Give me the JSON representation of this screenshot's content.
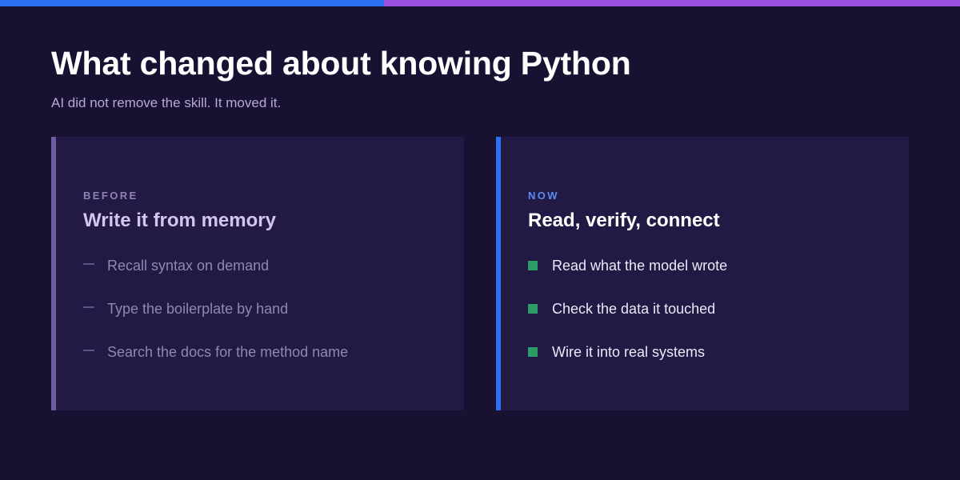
{
  "colors": {
    "background": "#181131",
    "card_background": "#221a44",
    "accent_blue": "#2d6ff2",
    "accent_purple": "#9b51e0",
    "before_border": "#6e5ca3",
    "before_kicker": "#8e83b4",
    "before_heading": "#d2c6f0",
    "before_item": "#9087b3",
    "before_marker": "#5d5386",
    "now_kicker": "#5b8cf5",
    "now_heading": "#ffffff",
    "now_item": "#ece8f7",
    "now_marker": "#2e9a6a"
  },
  "slide": {
    "title": "What changed about knowing Python",
    "subtitle": "AI did not remove the skill. It moved it."
  },
  "before": {
    "kicker": "BEFORE",
    "heading": "Write it from memory",
    "marker_icon": "dash-icon",
    "items": [
      "Recall syntax on demand",
      "Type the boilerplate by hand",
      "Search the docs for the method name"
    ]
  },
  "now": {
    "kicker": "NOW",
    "heading": "Read, verify, connect",
    "marker_icon": "square-icon",
    "items": [
      "Read what the model wrote",
      "Check the data it touched",
      "Wire it into real systems"
    ]
  }
}
